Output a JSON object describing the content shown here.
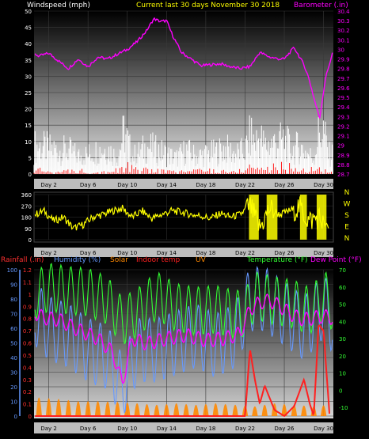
{
  "chart_data": [
    {
      "type": "line",
      "title": "Current last 30 days November 30 2018",
      "ylabel_left": "Windspeed (mph)",
      "ylabel_right": "Barometer (.in)",
      "x_ticks": [
        "Day 2",
        "Day 6",
        "Day 10",
        "Day 14",
        "Day 18",
        "Day 22",
        "Day 26",
        "Day 30"
      ],
      "xlim_days": [
        0.5,
        31
      ],
      "y_left_ticks": [
        "0",
        "5",
        "10",
        "15",
        "20",
        "25",
        "30",
        "35",
        "40",
        "45",
        "50"
      ],
      "ylim_left": [
        0,
        50
      ],
      "y_right_ticks": [
        "28.7",
        "28.8",
        "28.9",
        "29",
        "29.1",
        "29.2",
        "29.3",
        "29.4",
        "29.5",
        "29.6",
        "29.7",
        "29.8",
        "29.9",
        "30",
        "30.1",
        "30.2",
        "30.3",
        "30.4"
      ],
      "ylim_right": [
        28.7,
        30.4
      ],
      "series": [
        {
          "name": "Barometer",
          "axis": "right",
          "color": "#ff00ff",
          "x": [
            0.6,
            1,
            2,
            3,
            4,
            5,
            6,
            7,
            8,
            9,
            10,
            11,
            12,
            12.7,
            13.4,
            14,
            14.6,
            15.5,
            16.5,
            17.5,
            18.5,
            19.5,
            20.5,
            21.5,
            22.5,
            23.5,
            24.5,
            25.5,
            26,
            27,
            28,
            28.5,
            29,
            29.6,
            30.2,
            30.9
          ],
          "values": [
            29.95,
            29.93,
            29.96,
            29.88,
            29.8,
            29.9,
            29.82,
            29.92,
            29.9,
            29.95,
            30.0,
            30.08,
            30.2,
            30.32,
            30.29,
            30.3,
            30.15,
            29.97,
            29.9,
            29.83,
            29.84,
            29.85,
            29.82,
            29.8,
            29.82,
            29.97,
            29.92,
            29.9,
            29.9,
            30.02,
            29.84,
            29.7,
            29.5,
            29.28,
            29.7,
            29.96
          ]
        },
        {
          "name": "Wind gust",
          "axis": "left",
          "color": "#ffffff",
          "x": [
            1,
            2,
            3,
            4,
            5,
            6,
            7,
            8,
            9,
            9.7,
            10.5,
            11,
            12,
            13,
            14,
            15,
            16,
            17,
            18,
            19,
            20,
            21,
            22,
            22.6,
            23,
            23.5,
            24,
            25,
            26,
            26.8,
            27.5,
            28,
            29,
            29.5,
            30,
            30.5
          ],
          "values": [
            14,
            13,
            12,
            12,
            9,
            10,
            12,
            13,
            8,
            22,
            9,
            10,
            14,
            12,
            10,
            8,
            12,
            9,
            10,
            11,
            13,
            10,
            12,
            20,
            16,
            19,
            14,
            16,
            17,
            12,
            14,
            12,
            8,
            20,
            22,
            10
          ]
        },
        {
          "name": "Wind speed",
          "axis": "left",
          "color": "#ff2020",
          "x": [
            1,
            3,
            5,
            7,
            9,
            10,
            11,
            13,
            15,
            17,
            19,
            21,
            22.5,
            24,
            26,
            28,
            29.5,
            30.5
          ],
          "values": [
            2,
            1,
            2,
            1,
            2,
            4,
            2,
            2,
            1,
            2,
            2,
            1,
            4,
            3,
            4,
            2,
            3,
            1
          ]
        }
      ]
    },
    {
      "type": "line",
      "ylabel_left": "Wind direction",
      "y_left_ticks": [
        "360",
        "270",
        "180",
        "90",
        "0"
      ],
      "ylim_left": [
        0,
        360
      ],
      "y_right_ticks": [
        "N",
        "W",
        "S",
        "E",
        "N"
      ],
      "x_ticks": [
        "Day 2",
        "Day 6",
        "Day 10",
        "Day 14",
        "Day 18",
        "Day 22",
        "Day 26",
        "Day 30"
      ],
      "series": [
        {
          "name": "Wind direction",
          "color": "#ffff00",
          "x": [
            0.6,
            1.5,
            2.5,
            3.5,
            4.5,
            5.5,
            6.5,
            7.5,
            8.5,
            9.5,
            10.5,
            11.5,
            12.5,
            13.5,
            14.5,
            15.5,
            16.5,
            17.5,
            18.5,
            19.5,
            20.5,
            21.5,
            22.5,
            23.5,
            24.5,
            25.5,
            26.5,
            27.5,
            28.5,
            29.5,
            30.5
          ],
          "values": [
            200,
            230,
            150,
            180,
            90,
            120,
            180,
            200,
            230,
            250,
            180,
            230,
            170,
            200,
            230,
            220,
            200,
            190,
            170,
            210,
            180,
            200,
            270,
            90,
            250,
            200,
            230,
            260,
            150,
            180,
            90
          ]
        }
      ]
    },
    {
      "type": "line",
      "legend": [
        "Rainfall (.in)",
        "Humidity (%)",
        "Solar",
        "Indoor temp",
        "UV",
        "Temperature (°F)",
        "Dew Point (°F)"
      ],
      "x_ticks": [
        "Day 2",
        "Day 6",
        "Day 10",
        "Day 14",
        "Day 18",
        "Day 22",
        "Day 26",
        "Day 30"
      ],
      "y_left_ticks": [
        "100",
        "90",
        "80",
        "70",
        "60",
        "50",
        "40",
        "30",
        "20",
        "10",
        "0"
      ],
      "y_rain_ticks": [
        "1.2",
        "1.1",
        "1",
        "0.9",
        "0.8",
        "0.7",
        "0.6",
        "0.5",
        "0.4",
        "0.3",
        "0.2",
        "0.1",
        "0"
      ],
      "y_right_ticks": [
        "70",
        "60",
        "50",
        "40",
        "30",
        "20",
        "10",
        "0",
        "-10"
      ],
      "ylim_right": [
        -15,
        70
      ],
      "series": [
        {
          "name": "Temperature (°F)",
          "color": "#33ff33",
          "x": [
            0.6,
            2,
            4,
            6,
            8,
            9.5,
            11,
            13,
            15,
            17,
            19,
            21,
            22,
            23,
            25,
            27,
            28.5,
            30.2,
            30.9
          ],
          "values": [
            55,
            60,
            58,
            57,
            52,
            40,
            45,
            55,
            48,
            46,
            47,
            44,
            45,
            55,
            52,
            50,
            46,
            55,
            48
          ]
        },
        {
          "name": "Dew Point (°F)",
          "color": "#ff00ff",
          "x": [
            0.6,
            1.5,
            3,
            5,
            7,
            8.5,
            9.5,
            10.5,
            12,
            14,
            16,
            18,
            20,
            21.5,
            22.5,
            23.5,
            24.5,
            25.5,
            27,
            28,
            29,
            30,
            30.9
          ],
          "values": [
            45,
            42,
            41,
            35,
            30,
            22,
            4,
            30,
            27,
            30,
            32,
            29,
            30,
            33,
            47,
            51,
            52,
            49,
            43,
            41,
            42,
            43,
            42
          ]
        },
        {
          "name": "Humidity (%)",
          "color": "#6699ff",
          "x": [
            0.6,
            2,
            4,
            6,
            8,
            9.5,
            11,
            13,
            15,
            17,
            19,
            21,
            22.5,
            24,
            26,
            28,
            30,
            30.9
          ],
          "values": [
            70,
            60,
            55,
            45,
            40,
            20,
            45,
            45,
            50,
            55,
            48,
            55,
            80,
            80,
            70,
            60,
            75,
            65
          ]
        },
        {
          "name": "Rainfall (.in)",
          "color": "#ff2020",
          "x": [
            0.6,
            21,
            22,
            22.5,
            23,
            23.5,
            24,
            25,
            26,
            27,
            28,
            28.6,
            29,
            29.5,
            30,
            30.6
          ],
          "values": [
            0,
            0,
            0,
            0.55,
            0.3,
            0.1,
            0.25,
            0.05,
            0,
            0.08,
            0.3,
            0.1,
            0,
            0.75,
            0.7,
            0.02
          ]
        },
        {
          "name": "Solar",
          "color": "#ff8800",
          "x": [
            1,
            3,
            5,
            7,
            9,
            11,
            13,
            15,
            17,
            19,
            21,
            23,
            25,
            27,
            29,
            30.5
          ],
          "values": [
            20,
            18,
            15,
            15,
            14,
            12,
            10,
            12,
            10,
            12,
            10,
            8,
            12,
            10,
            8,
            10
          ]
        }
      ]
    }
  ]
}
